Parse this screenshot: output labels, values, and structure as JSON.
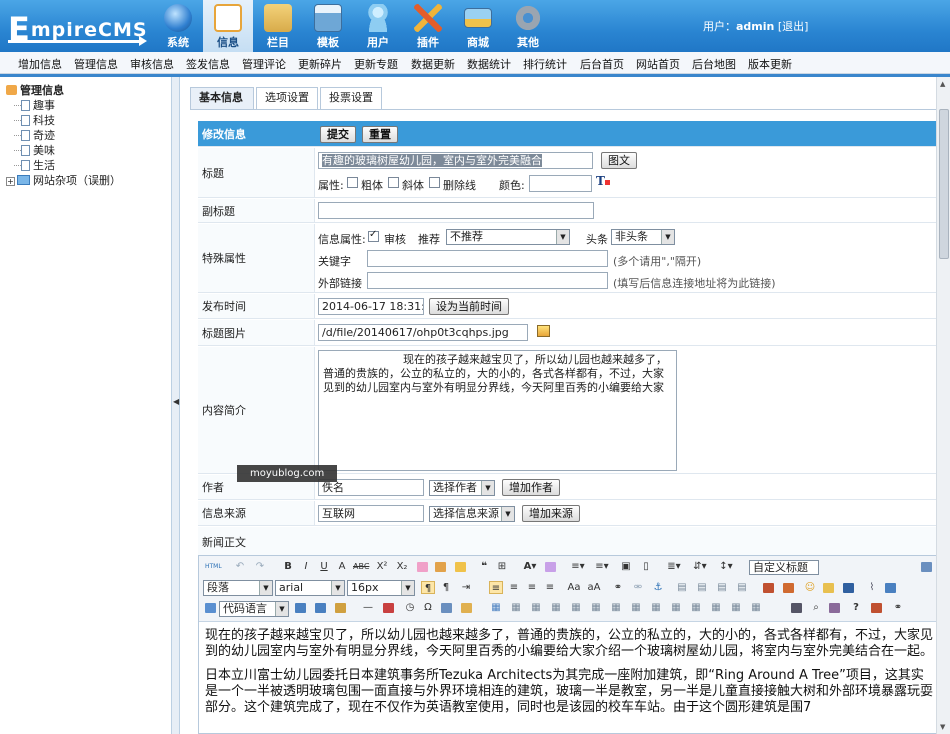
{
  "app": {
    "logo_letter": "E",
    "logo_text": "mpireCMS"
  },
  "main_nav": [
    {
      "label": "系统",
      "icon": "globe-icon",
      "color": "#2f7fd0"
    },
    {
      "label": "信息",
      "icon": "notepad-icon",
      "color": "#e7a53b"
    },
    {
      "label": "栏目",
      "icon": "folder-icon",
      "color": "#d8ab4a"
    },
    {
      "label": "模板",
      "icon": "template-window-icon",
      "color": "#6ea7d6"
    },
    {
      "label": "用户",
      "icon": "user-icon",
      "color": "#8ecdf2"
    },
    {
      "label": "插件",
      "icon": "tools-icon",
      "color": "#e35d2b"
    },
    {
      "label": "商城",
      "icon": "card-icon",
      "color": "#f0c24a"
    },
    {
      "label": "其他",
      "icon": "gear-icon",
      "color": "#9aa5b1"
    }
  ],
  "user": {
    "prefix": "用户：",
    "name": "admin",
    "logout": "[退出]"
  },
  "sub_nav": [
    "增加信息",
    "管理信息",
    "审核信息",
    "签发信息",
    "管理评论",
    "更新碎片",
    "更新专题",
    "数据更新",
    "数据统计",
    "排行统计",
    "后台首页",
    "网站首页",
    "后台地图",
    "版本更新"
  ],
  "tree": {
    "root": "管理信息",
    "items": [
      "趣事",
      "科技",
      "奇迹",
      "美味",
      "生活"
    ],
    "folder": "网站杂项（误删）"
  },
  "tabs": [
    "基本信息",
    "选项设置",
    "投票设置"
  ],
  "form": {
    "header_label": "修改信息",
    "submit": "提交",
    "reset": "重置",
    "title_label": "标题",
    "title_value": "有趣的玻璃树屋幼儿园，室内与室外完美融合",
    "title_img_btn": "图文",
    "attr_label": "属性:",
    "bold": "粗体",
    "italic": "斜体",
    "strike": "删除线",
    "color_label": "颜色:",
    "subtitle_label": "副标题",
    "special_label": "特殊属性",
    "info_attr": "信息属性:",
    "audit": "审核",
    "recommend": "推荐",
    "recommend_value": "不推荐",
    "headline": "头条",
    "headline_value": "非头条",
    "keyword_label": "关键字",
    "keyword_hint": "(多个请用\",\"隔开)",
    "link_label": "外部链接",
    "link_hint": "(填写后信息连接地址将为此链接)",
    "time_label": "发布时间",
    "time_value": "2014-06-17 18:31:04",
    "time_btn": "设为当前时间",
    "pic_label": "标题图片",
    "pic_value": "/d/file/20140617/ohp0t3cqhps.jpg",
    "intro_label": "内容简介",
    "intro_value": "现在的孩子越来越宝贝了，所以幼儿园也越来越多了，普通的贵族的，公立的私立的，大的小的，各式各样都有，不过，大家见到的幼儿园室内与室外有明显分界线，今天阿里百秀的小编要给大家",
    "author_label": "作者",
    "author_value": "佚名",
    "author_select": "选择作者",
    "author_btn": "增加作者",
    "source_label": "信息来源",
    "source_value": "互联网",
    "source_select": "选择信息来源",
    "source_btn": "增加来源",
    "body_label": "新闻正文"
  },
  "watermark": "moyublog.com",
  "editor": {
    "format": "段落",
    "font": "arial",
    "size": "16px",
    "codelang": "代码语言",
    "custom_title": "自定义标题",
    "p1": "现在的孩子越来越宝贝了，所以幼儿园也越来越多了，普通的贵族的，公立的私立的，大的小的，各式各样都有，不过，大家见到的幼儿园室内与室外有明显分界线，今天阿里百秀的小编要给大家介绍一个玻璃树屋幼儿园，将室内与室外完美结合在一起。",
    "p2": "日本立川富士幼儿园委托日本建筑事务所Tezuka Architects为其完成一座附加建筑，即“Ring Around A Tree”项目，这其实是一个一半被透明玻璃包围一面直接与外界环境相连的建筑，玻璃一半是教室，另一半是儿童直接接触大树和外部环境暴露玩耍部分。这个建筑完成了，现在不仅作为英语教室使用，同时也是该园的校车车站。由于这个圆形建筑是围7"
  }
}
